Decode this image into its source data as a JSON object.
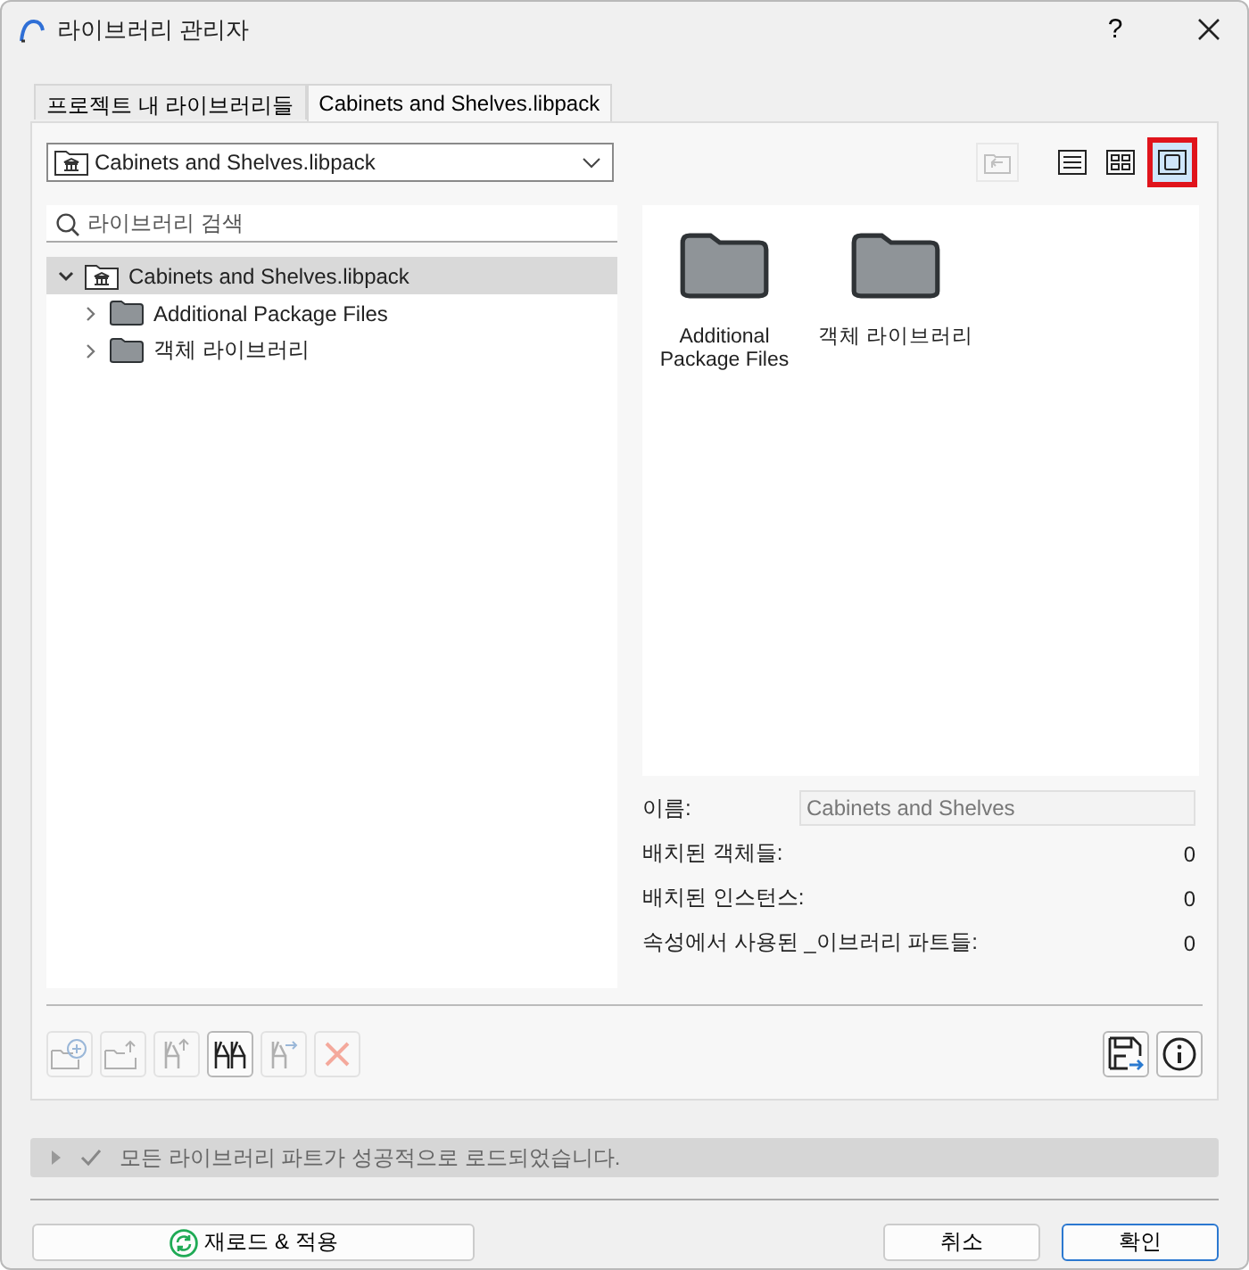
{
  "window": {
    "title": "라이브러리 관리자",
    "help": "?"
  },
  "tabs": [
    {
      "label": "프로젝트 내 라이브러리들",
      "selected": false
    },
    {
      "label": "Cabinets and Shelves.libpack",
      "selected": true
    }
  ],
  "library_dropdown": {
    "value": "Cabinets and Shelves.libpack"
  },
  "up_button": {
    "disabled": true
  },
  "view_buttons": [
    {
      "kind": "list",
      "selected": false
    },
    {
      "kind": "grid",
      "selected": false
    },
    {
      "kind": "large",
      "selected": true
    }
  ],
  "search": {
    "placeholder": "라이브러리 검색"
  },
  "tree": [
    {
      "label": "Cabinets and Shelves.libpack",
      "kind": "package",
      "expanded": true,
      "selected": true,
      "children": [
        {
          "label": "Additional Package Files",
          "kind": "folder",
          "expanded": false,
          "selected": false
        },
        {
          "label": "객체 라이브러리",
          "kind": "folder",
          "expanded": false,
          "selected": false
        }
      ]
    }
  ],
  "preview_items": [
    {
      "label": "Additional Package Files"
    },
    {
      "label": "객체 라이브러리"
    }
  ],
  "info": {
    "name_label": "이름:",
    "name_value": "Cabinets and Shelves",
    "stats": [
      {
        "label": "배치된 객체들:",
        "value": "0"
      },
      {
        "label": "배치된 인스턴스:",
        "value": "0"
      },
      {
        "label": "속성에서 사용된 _이브러리 파트들:",
        "value": "0"
      }
    ]
  },
  "tools": [
    {
      "kind": "add-folder",
      "disabled": true,
      "selected": false
    },
    {
      "kind": "export-folder",
      "disabled": true,
      "selected": false
    },
    {
      "kind": "export-chair",
      "disabled": true,
      "selected": false
    },
    {
      "kind": "chairs",
      "disabled": false,
      "selected": true
    },
    {
      "kind": "move-chair",
      "disabled": true,
      "selected": false
    },
    {
      "kind": "delete",
      "disabled": true,
      "selected": false
    }
  ],
  "side_tools": [
    {
      "kind": "save"
    },
    {
      "kind": "info"
    }
  ],
  "status": {
    "expanded": false,
    "text": "모든 라이브러리 파트가 성공적으로 로드되었습니다."
  },
  "buttons": [
    {
      "label": "재로드 & 적용",
      "kind": "reload",
      "default": false
    },
    {
      "label": "취소",
      "kind": "cancel",
      "default": false
    },
    {
      "label": "확인",
      "kind": "ok",
      "default": true
    }
  ]
}
